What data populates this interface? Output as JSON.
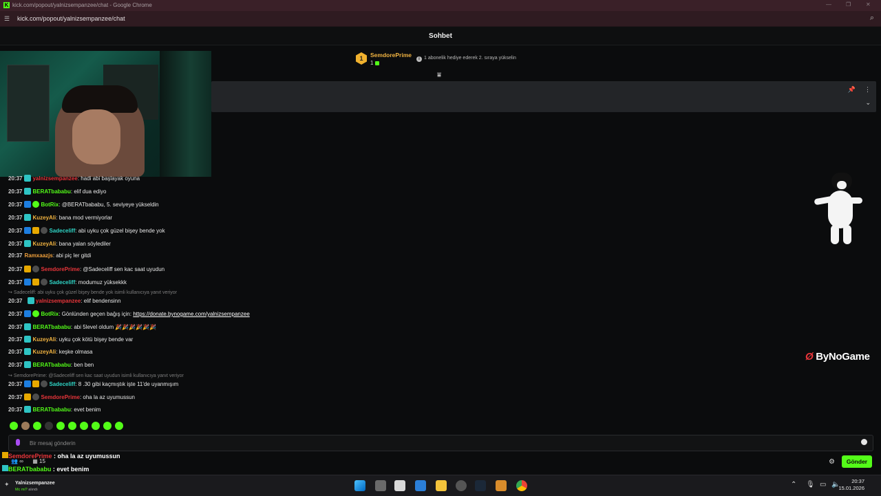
{
  "browser": {
    "window_title": "kick.com/popout/yalnizsempanzee/chat - Google Chrome",
    "url": "kick.com/popout/yalnizsempanzee/chat"
  },
  "chat": {
    "title": "Sohbet",
    "leaderboard": {
      "rank": "1",
      "name": "SemdorePrime",
      "count": "1"
    },
    "promo_text": "1 abonelik hediye ederek 2. sıraya yükselin",
    "input_placeholder": "Bir mesaj gönderin",
    "send_label": "Gönder"
  },
  "messages": [
    {
      "time": "20:37",
      "user": "yalnizsempanzee",
      "text": ": hadi abi başlayak oyuna"
    },
    {
      "time": "20:37",
      "user": "BERATbababu",
      "text": ": elif dua ediyo"
    },
    {
      "time": "20:37",
      "user": "BotRix",
      "text": ": @BERATbababu, 5. seviyeye yükseldin"
    },
    {
      "time": "20:37",
      "user": "KuzeyAli",
      "text": ": bana mod vermiyorlar"
    },
    {
      "time": "20:37",
      "user": "Sadeceliff",
      "text": ": abi uyku çok güzel bişey bende yok"
    },
    {
      "time": "20:37",
      "user": "KuzeyAli",
      "text": ": bana yalan söylediler"
    },
    {
      "time": "20:37",
      "user": "Ramxaazjs",
      "text": ": abi piç ler gitdi"
    },
    {
      "time": "20:37",
      "user": "SemdorePrime",
      "text": ": @Sadeceliff sen kac saat uyudun"
    },
    {
      "time": "20:37",
      "user": "Sadeceliff",
      "text": ": modumuz yüksekkk"
    },
    {
      "reply": "Sadeceliff: abi uyku çok güzel bişey bende yok isimli kullanıcıya yanıt veriyor"
    },
    {
      "time": "20:37",
      "user": "yalnizsempanzee",
      "text": ": elif bendensinn"
    },
    {
      "time": "20:37",
      "user": "BotRix",
      "text": ": Gönlünden geçen bağış için: ",
      "link": "https://donate.bynogame.com/yalnizsempanzee"
    },
    {
      "time": "20:37",
      "user": "BERATbababu",
      "text": ": abi 5level oldum 🎉🎉🎉🎉🎉🎉"
    },
    {
      "time": "20:37",
      "user": "KuzeyAli",
      "text": ": uyku çok kötü bişey bende var"
    },
    {
      "time": "20:37",
      "user": "KuzeyAli",
      "text": ": keşke olmasa"
    },
    {
      "time": "20:37",
      "user": "BERATbababu",
      "text": ": ben ben"
    },
    {
      "reply": "SemdorePrime: @Sadeceliff sen kac saat uyudun isimli kullanıcıya yanıt veriyor"
    },
    {
      "time": "20:37",
      "user": "Sadeceliff",
      "text": ": 8 .30 gibi kaçmıştık işte 11'de uyanmışım"
    },
    {
      "time": "20:37",
      "user": "SemdorePrime",
      "text": ": oha la az uyumussun"
    },
    {
      "time": "20:37",
      "user": "BERATbababu",
      "text": ": evet benim"
    }
  ],
  "overlay": {
    "line1_user": "SemdorePrime",
    "line1_text": " : oha la az uyumussun",
    "line2_user": "BERATbababu",
    "line2_text": " : evet benim",
    "viewers": "∞",
    "count": "15"
  },
  "sponsor": {
    "brand": "ByNoGame"
  },
  "taskbar": {
    "user": "Yalnizsempanzee",
    "status": "Mc mi?",
    "status_sub": " alındı",
    "time": "20:37",
    "date": "15.01.2026"
  },
  "colors": {
    "kick_green": "#53fc18",
    "name_red": "#e8353a",
    "name_green": "#53fc18",
    "name_yellow": "#f2b441",
    "name_teal": "#2fd5c6",
    "name_orange": "#f0a03c"
  }
}
